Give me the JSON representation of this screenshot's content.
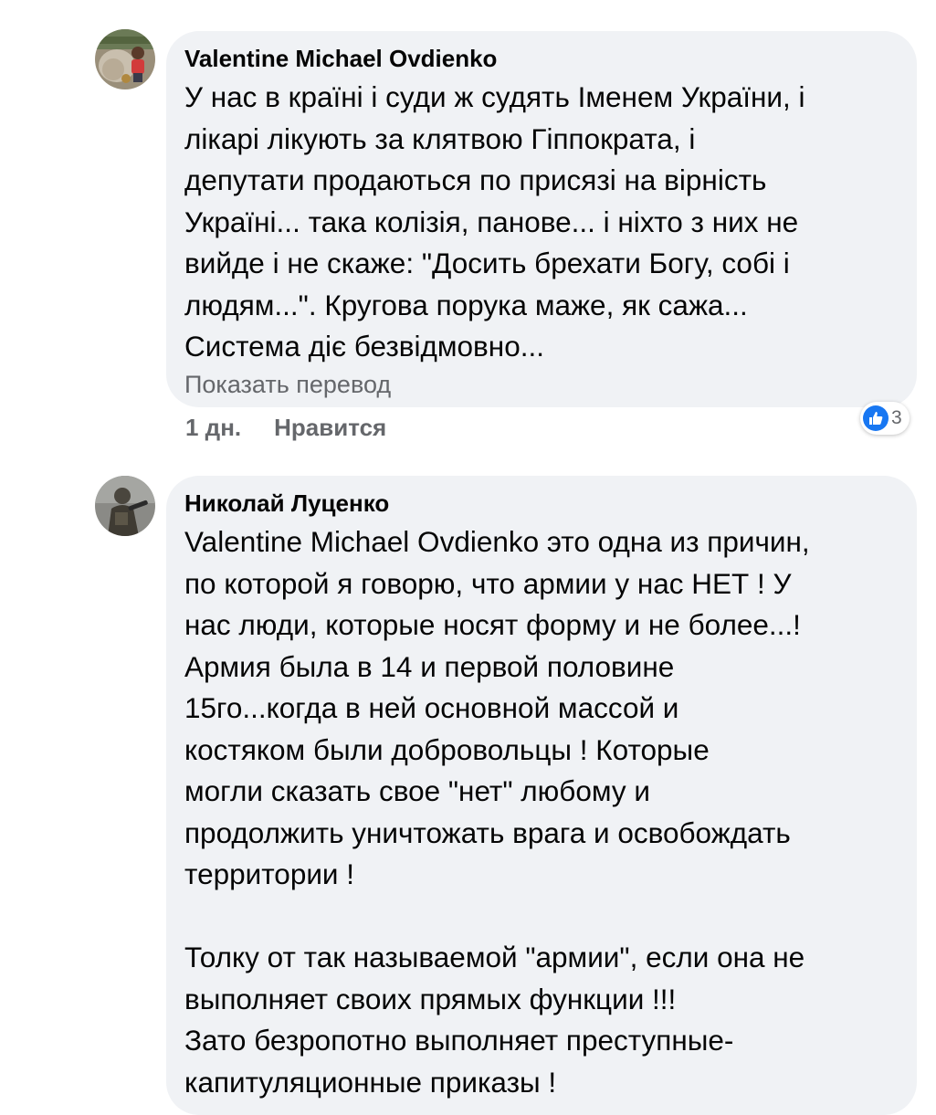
{
  "comments": [
    {
      "author": "Valentine Michael Ovdienko",
      "text": "У нас в країні і суди ж судять Іменем України, і\nлікарі лікують за клятвою Гіппократа, і\nдепутати продаються по присязі на вірність\nУкраїні... така колізія, панове... і ніхто з них не\nвийде і не скаже: \"Досить брехати Богу, собі і\nлюдям...\". Кругова порука маже, як сажа...\nСистема діє безвідмовно...",
      "translate_label": "Показать перевод",
      "time": "1 дн.",
      "like_label": "Нравится",
      "reaction_icon": "like-icon",
      "reaction_count": "3",
      "colors": {
        "like": "#1877f2"
      }
    },
    {
      "author": "Николай Луценко",
      "text": "Valentine Michael Ovdienko это одна из причин,\nпо которой я говорю, что армии у нас НЕТ ! У\nнас люди, которые носят форму   и не более...!\nАрмия была в 14 и первой половине\n15го...когда в ней основной массой и\nкостяком были добровольцы ! Которые\nмогли сказать свое \"нет\" любому и\nпродолжить уничтожать врага и освобождать\nтерритории !\n\nТолку от так называемой \"армии\", если она не\nвыполняет своих прямых функции !!!\nЗато безропотно выполняет преступные-\nкапитуляционные приказы !"
    }
  ]
}
